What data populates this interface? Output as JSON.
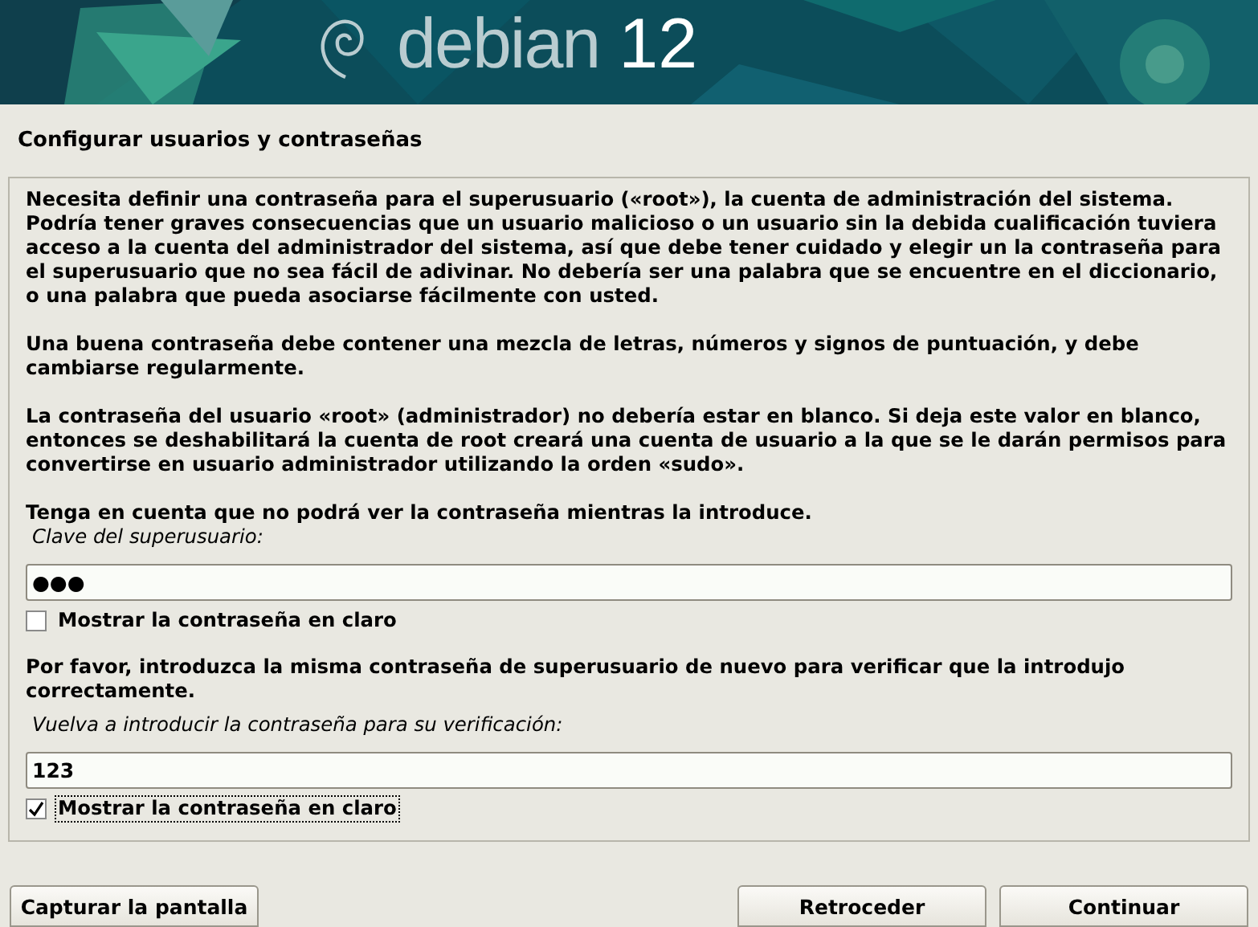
{
  "banner": {
    "brand": "debian",
    "version": "12"
  },
  "title": "Configurar usuarios y contraseñas",
  "paragraphs": [
    "Necesita definir una contraseña para el superusuario («root»), la cuenta de administración del sistema. Podría tener graves consecuencias que un usuario malicioso o un usuario sin la debida cualificación tuviera acceso a la cuenta del administrador del sistema, así que debe tener cuidado y elegir un la contraseña para el superusuario que no sea fácil de adivinar. No debería ser una palabra que se encuentre en el diccionario, o una palabra que pueda asociarse fácilmente con usted.",
    "Una buena contraseña debe contener una mezcla de letras, números y signos de puntuación, y debe cambiarse regularmente.",
    "La contraseña del usuario «root» (administrador) no debería estar en blanco. Si deja este valor en blanco, entonces se deshabilitará la cuenta de root creará una cuenta de usuario a la que se le darán permisos para convertirse en usuario administrador utilizando la orden «sudo».",
    "Tenga en cuenta que no podrá ver la contraseña mientras la introduce."
  ],
  "fields": [
    {
      "label": "Clave del superusuario:",
      "value": "●●●",
      "show_checkbox": {
        "label": "Mostrar la contraseña en claro",
        "checked": false,
        "focused": false
      }
    },
    {
      "intro": "Por favor, introduzca la misma contraseña de superusuario de nuevo para verificar que la introdujo correctamente.",
      "label": "Vuelva a introducir la contraseña para su verificación:",
      "value": "123",
      "show_checkbox": {
        "label": "Mostrar la contraseña en claro",
        "checked": true,
        "focused": true
      }
    }
  ],
  "buttons": {
    "left": [
      "Capturar la pantalla"
    ],
    "right": [
      "Retroceder",
      "Continuar"
    ]
  }
}
